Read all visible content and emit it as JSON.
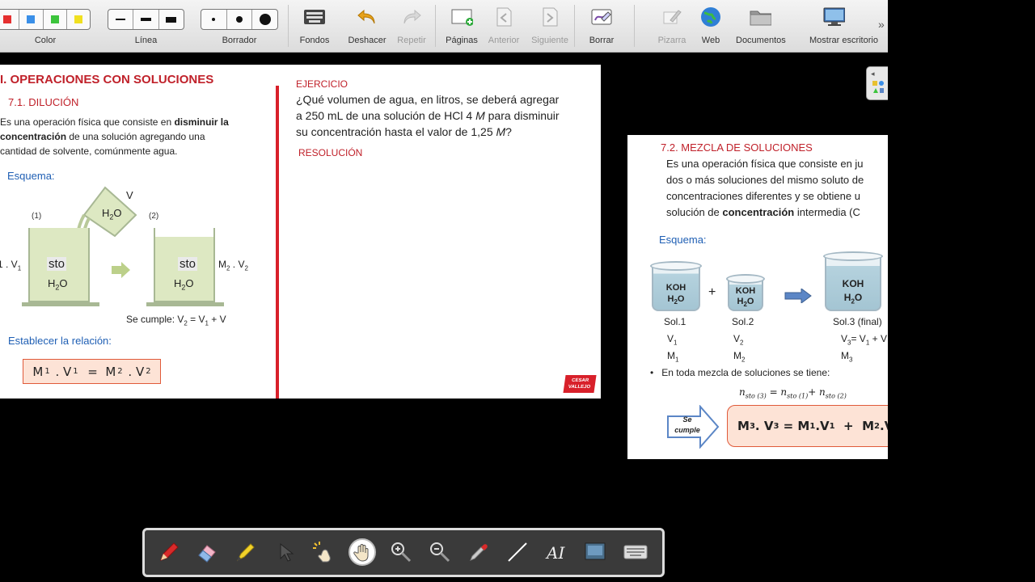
{
  "toolbar": {
    "color_label": "Color",
    "line_label": "Línea",
    "eraser_label": "Borrador",
    "fondos_label": "Fondos",
    "deshacer_label": "Deshacer",
    "repetir_label": "Repetir",
    "paginas_label": "Páginas",
    "anterior_label": "Anterior",
    "siguiente_label": "Siguiente",
    "borrar_label": "Borrar",
    "pizarra_label": "Pizarra",
    "web_label": "Web",
    "documentos_label": "Documentos",
    "mostrar_label": "Mostrar escritorio",
    "more": "»",
    "swatches": [
      "#e53030",
      "#3a8fe8",
      "#3cc43c",
      "#f0e020"
    ]
  },
  "left_slide": {
    "title": "I. OPERACIONES CON SOLUCIONES",
    "subtitle": "7.1. DILUCIÓN",
    "desc_1a": "Es una operación física que consiste en ",
    "desc_1b": "disminuir la",
    "desc_2a": "concentración",
    "desc_2b": " de una solución agregando una",
    "desc_3": "cantidad de solvente, comúnmente agua.",
    "esquema": "Esquema:",
    "step1": "(1)",
    "step2": "(2)",
    "v_label": "V",
    "h2o": "H",
    "o": "O",
    "sub2": "2",
    "sto": "sto",
    "m1v1": "1 . V",
    "m2v2": "M",
    "se_cumple": "Se cumple: V",
    "establecer": "Establecer la relación:",
    "relation": "M",
    "ejercicio": "EJERCICIO",
    "q1a": "¿Qué volumen de agua, en litros, se deberá agregar",
    "q2a": "a 250 mL de una solución de HCl 4 ",
    "q2b": "M",
    "q2c": " para disminuir",
    "q3a": "su concentración hasta el valor de  1,25 ",
    "q3b": "M",
    "q3c": "?",
    "resolucion": "RESOLUCIÓN",
    "logo_1": "CESAR",
    "logo_2": "VALLEJO"
  },
  "right_slide": {
    "title": "7.2. MEZCLA DE SOLUCIONES",
    "d1": "Es una operación física que consiste en ju",
    "d2": "dos o más soluciones del mismo soluto de",
    "d3": "concentraciones diferentes y se obtiene u",
    "d4a": "solución de  ",
    "d4b": "concentración",
    "d4c": "  intermedia (C",
    "esquema": "Esquema:",
    "koh": "KOH",
    "plus": "+",
    "sol1": "Sol.1",
    "sol2": "Sol.2",
    "sol3": "Sol.3 (final)",
    "v": "V",
    "m": "M",
    "v3eq": "= V",
    "bullet": "En toda mezcla de soluciones se tiene:",
    "nsto": "n",
    "se": "Se",
    "cumple": "cumple",
    "formula": "M"
  },
  "bottom_tools": [
    "pen-icon",
    "eraser-icon",
    "highlighter-icon",
    "cursor-icon",
    "magic-wand-icon",
    "hand-icon",
    "zoom-in-icon",
    "zoom-out-icon",
    "eyedropper-icon",
    "line-icon",
    "text-icon",
    "screen-icon",
    "keyboard-icon"
  ]
}
